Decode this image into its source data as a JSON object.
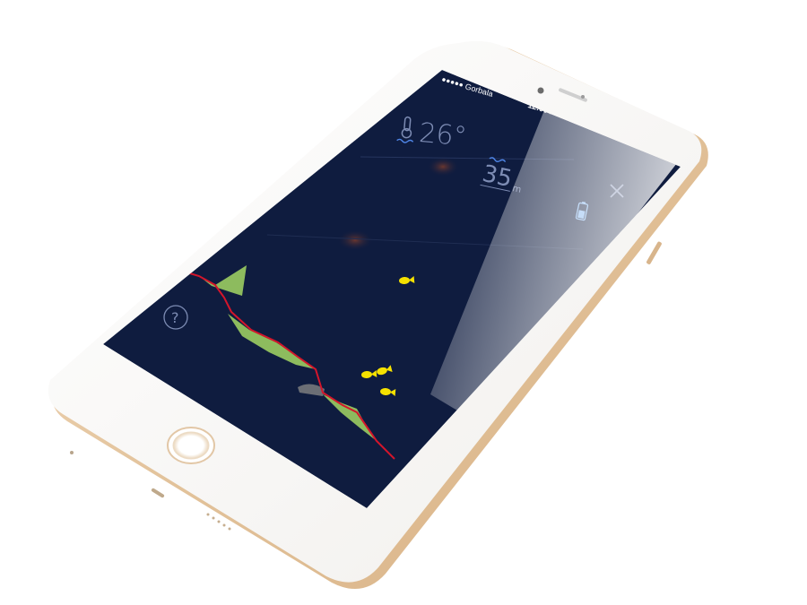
{
  "status_bar": {
    "carrier": "Gorbala",
    "time": "12:00 AM",
    "signal_dots": 5
  },
  "readings": {
    "temperature": "26°",
    "depth": "35",
    "depth_unit": "m"
  },
  "icons": {
    "temperature": "thermometer-icon",
    "depth": "water-waves-icon",
    "battery": "battery-icon",
    "close": "close-icon",
    "help": "question-mark-icon",
    "fish": "fish-icon"
  },
  "colors": {
    "screen_bg": "#0f1c3f",
    "ui_text": "#7d8cb4",
    "bottom_line": "#d4152b",
    "vegetation": "#8dbb5e",
    "fish": "#f5e100",
    "battery": "#7fb3ef",
    "phone_body": "#f8f7f5",
    "phone_rim": "#e7c9a4"
  }
}
